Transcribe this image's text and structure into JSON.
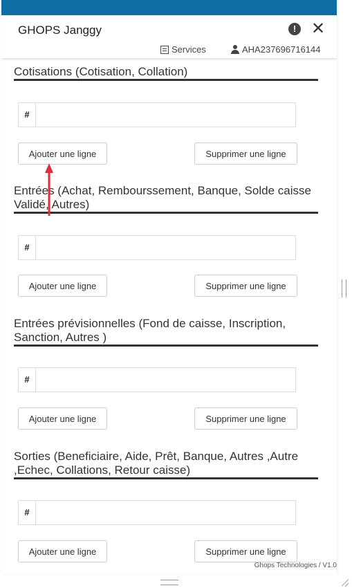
{
  "colors": {
    "topbar": "#0e6ea3",
    "arrow": "#e8293c",
    "border": "#333333"
  },
  "header": {
    "title": "GHOPS Janggy",
    "alert_icon": "exclamation-circle-icon",
    "close_icon": "close-icon",
    "services_label": "Services",
    "user_label": "AHA237696716144"
  },
  "sections": [
    {
      "title": "Cotisations (Cotisation, Collation)",
      "hash": "#",
      "add_label": "Ajouter une ligne",
      "delete_label": "Supprimer une ligne"
    },
    {
      "title": "Entrées (Achat, Rembourssement, Banque, Solde caisse Validé, Autres)",
      "hash": "#",
      "add_label": "Ajouter une ligne",
      "delete_label": "Supprimer une ligne"
    },
    {
      "title": "Entrées prévisionnelles (Fond de caisse, Inscription, Sanction, Autres )",
      "hash": "#",
      "add_label": "Ajouter une ligne",
      "delete_label": "Supprimer une ligne"
    },
    {
      "title": "Sorties (Beneficiaire, Aide, Prêt, Banque, Autres ,Autre ,Echec, Collations, Retour caisse)",
      "hash": "#",
      "add_label": "Ajouter une ligne",
      "delete_label": "Supprimer une ligne"
    }
  ],
  "footer": {
    "text": "Ghops Technologies / V1.0"
  }
}
